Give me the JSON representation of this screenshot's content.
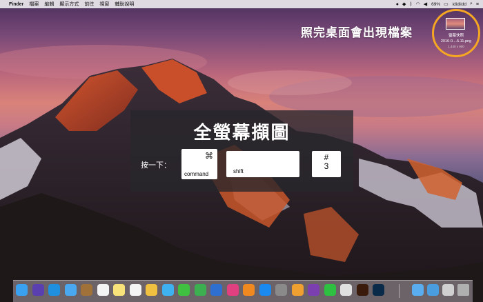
{
  "menubar": {
    "app_name": "Finder",
    "menus": [
      "檔案",
      "編輯",
      "顯示方式",
      "前往",
      "視窗",
      "輔助說明"
    ],
    "battery": "69%",
    "username": "ididiidd"
  },
  "desktop": {
    "caption": "照完桌面會出現檔案",
    "file": {
      "name": "螢幕快照",
      "subname": "2016-0....5.11.png",
      "size": "1,440 x 900"
    }
  },
  "panel": {
    "title": "全螢幕擷圖",
    "press_label": "按一下：",
    "keys": {
      "command_symbol": "⌘",
      "command_label": "command",
      "shift_label": "shift",
      "three_symbol": "#",
      "three_label": "3"
    }
  },
  "dock": {
    "icons": [
      "finder-icon",
      "siri-icon",
      "safari-icon",
      "mail-icon",
      "contacts-icon",
      "calendar-icon",
      "notes-icon",
      "reminders-icon",
      "photos-icon",
      "messages-icon",
      "facetime-icon",
      "numbers-icon",
      "keynote-icon",
      "itunes-icon",
      "ibooks-icon",
      "app-store-icon",
      "system-preferences-icon",
      "butterfly-icon",
      "onenote-icon",
      "line-icon",
      "chrome-icon",
      "illustrator-icon",
      "photoshop-icon",
      "folder-icon",
      "downloads-icon",
      "document-icon",
      "trash-icon"
    ]
  }
}
